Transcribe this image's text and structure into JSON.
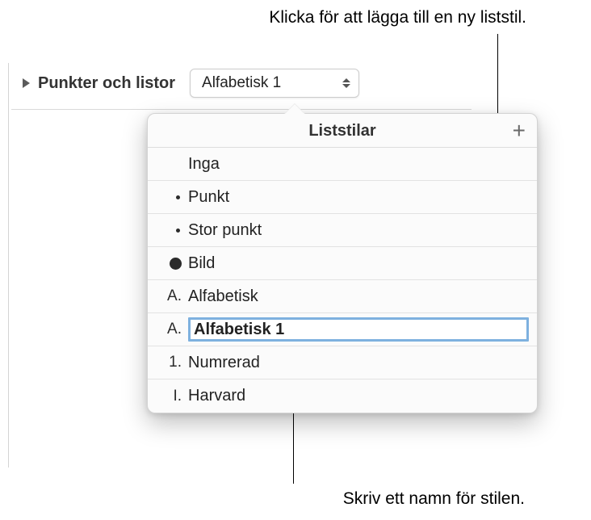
{
  "callouts": {
    "top": "Klicka för att lägga till en ny liststil.",
    "bottom": "Skriv ett namn för stilen."
  },
  "header": {
    "label": "Punkter och listor",
    "selected": "Alfabetisk 1"
  },
  "popover": {
    "title": "Liststilar",
    "add_icon": "plus-icon",
    "styles": [
      {
        "marker": "",
        "marker_type": "none",
        "name": "Inga"
      },
      {
        "marker": "",
        "marker_type": "dot-small",
        "name": "Punkt"
      },
      {
        "marker": "",
        "marker_type": "dot-small",
        "name": "Stor punkt"
      },
      {
        "marker": "",
        "marker_type": "dot-large",
        "name": "Bild"
      },
      {
        "marker": "A.",
        "marker_type": "text",
        "name": "Alfabetisk"
      },
      {
        "marker": "A.",
        "marker_type": "text",
        "name": "Alfabetisk 1",
        "editing": true
      },
      {
        "marker": "1.",
        "marker_type": "text",
        "name": "Numrerad"
      },
      {
        "marker": "I.",
        "marker_type": "text",
        "name": "Harvard"
      }
    ]
  }
}
